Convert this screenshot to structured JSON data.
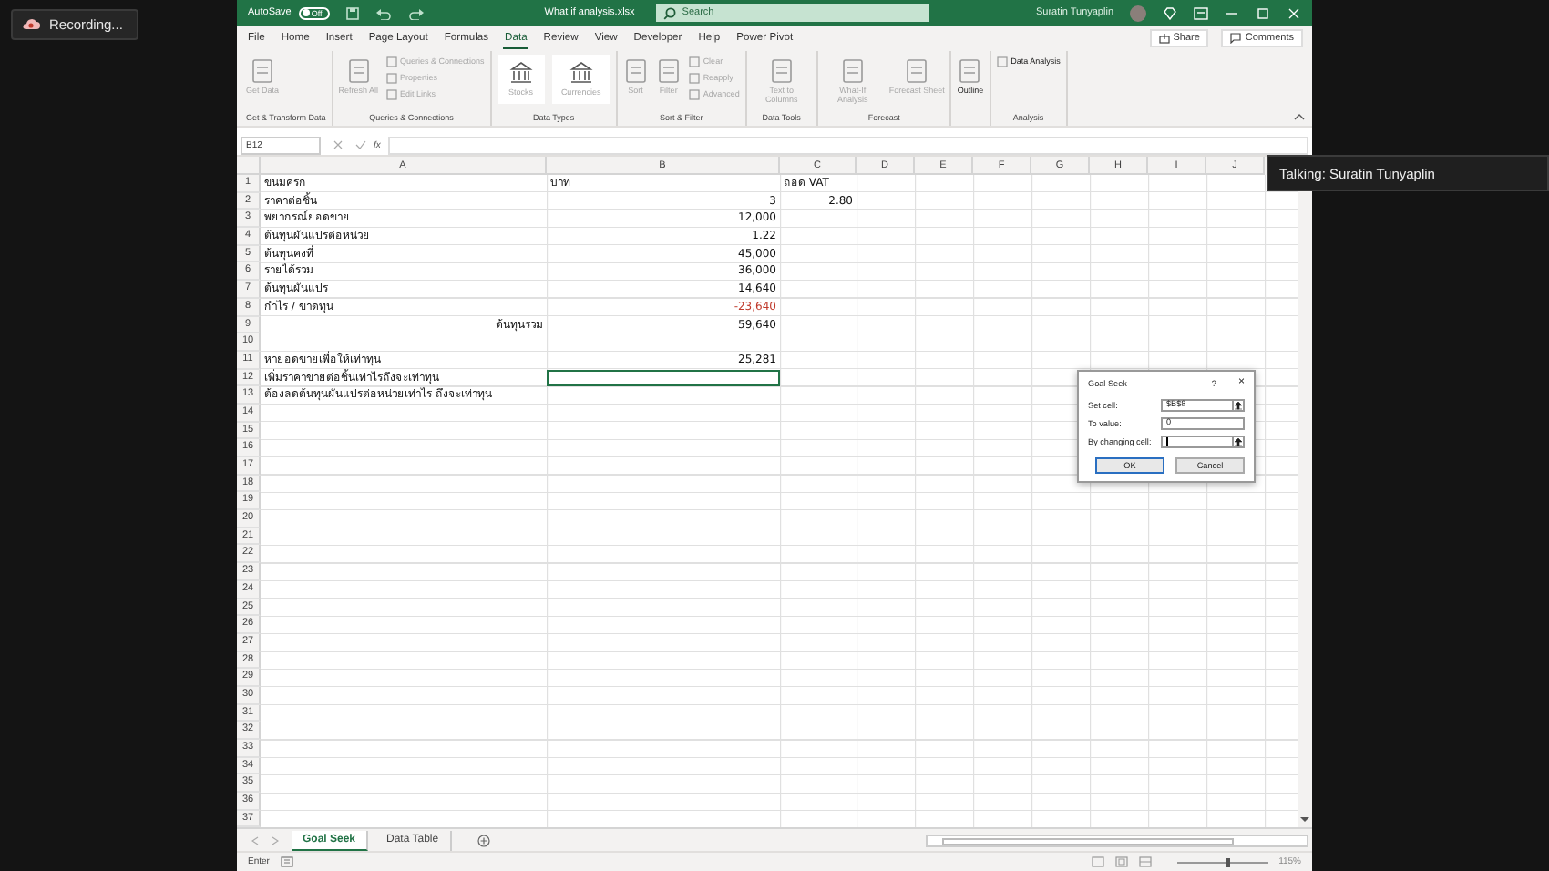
{
  "recording": {
    "label": "Recording..."
  },
  "talking": {
    "label": "Talking: Suratin Tunyaplin"
  },
  "title_bar": {
    "autosave_label": "AutoSave",
    "autosave_toggle": {
      "label": "Off",
      "on": false
    },
    "filename": "What if analysis.xlsx",
    "search": {
      "placeholder": "Search"
    },
    "user": "Suratin Tunyaplin"
  },
  "menu_tabs": [
    {
      "label": "File",
      "selected": false
    },
    {
      "label": "Home",
      "selected": false
    },
    {
      "label": "Insert",
      "selected": false
    },
    {
      "label": "Page Layout",
      "selected": false
    },
    {
      "label": "Formulas",
      "selected": false
    },
    {
      "label": "Data",
      "selected": true
    },
    {
      "label": "Review",
      "selected": false
    },
    {
      "label": "View",
      "selected": false
    },
    {
      "label": "Developer",
      "selected": false
    },
    {
      "label": "Help",
      "selected": false
    },
    {
      "label": "Power Pivot",
      "selected": false
    }
  ],
  "header_buttons": [
    "Share",
    "Comments"
  ],
  "ribbon_groups": [
    {
      "label": "Get & Transform Data",
      "items": [
        {
          "kind": "large",
          "label": "Get Data",
          "disabled": true
        }
      ]
    },
    {
      "label": "Queries & Connections",
      "items": [
        {
          "kind": "large",
          "label": "Refresh All",
          "disabled": true
        },
        {
          "kind": "small",
          "label": "Queries & Connections",
          "disabled": true
        },
        {
          "kind": "small",
          "label": "Properties",
          "disabled": true
        },
        {
          "kind": "small",
          "label": "Edit Links",
          "disabled": true
        }
      ]
    },
    {
      "label": "Data Types",
      "items": [
        {
          "kind": "gallery",
          "label": "Stocks",
          "disabled": true
        },
        {
          "kind": "gallery",
          "label": "Currencies",
          "disabled": true
        }
      ]
    },
    {
      "label": "Sort & Filter",
      "items": [
        {
          "kind": "large",
          "label": "Sort",
          "disabled": true
        },
        {
          "kind": "large",
          "label": "Filter",
          "disabled": true
        },
        {
          "kind": "small",
          "label": "Clear",
          "disabled": true
        },
        {
          "kind": "small",
          "label": "Reapply",
          "disabled": true
        },
        {
          "kind": "small",
          "label": "Advanced",
          "disabled": true
        }
      ]
    },
    {
      "label": "Data Tools",
      "items": [
        {
          "kind": "large",
          "label": "Text to Columns",
          "disabled": true
        }
      ]
    },
    {
      "label": "Forecast",
      "items": [
        {
          "kind": "large",
          "label": "What-If Analysis",
          "disabled": true
        },
        {
          "kind": "large",
          "label": "Forecast Sheet",
          "disabled": true
        }
      ]
    },
    {
      "items": [
        {
          "kind": "large",
          "label": "Outline",
          "disabled": false
        }
      ]
    },
    {
      "label": "Analysis",
      "items": [
        {
          "kind": "small",
          "label": "Data Analysis",
          "disabled": false
        }
      ]
    }
  ],
  "formula_bar": {
    "name_box": "B12",
    "fx": "fx"
  },
  "columns": [
    "A",
    "B",
    "C",
    "D",
    "E",
    "F",
    "G",
    "H",
    "I",
    "J"
  ],
  "rows": [
    {
      "number": "1",
      "a": {
        "text": "ขนมครก",
        "kind": "text"
      },
      "b": {
        "text": "บาท",
        "kind": "text"
      },
      "c": {
        "text": "ถอด VAT",
        "kind": "text"
      },
      "selected": false
    },
    {
      "number": "2",
      "a": {
        "text": "ราคาต่อชิ้น",
        "kind": "text"
      },
      "b": {
        "text": "3",
        "kind": "number"
      },
      "c": {
        "text": "2.80",
        "kind": "number"
      },
      "selected": false
    },
    {
      "number": "3",
      "a": {
        "text": "พยากรณ์ยอดขาย",
        "kind": "text"
      },
      "b": {
        "text": "12,000",
        "kind": "number"
      },
      "selected": false
    },
    {
      "number": "4",
      "a": {
        "text": "ต้นทุนผันแปรต่อหน่วย",
        "kind": "text"
      },
      "b": {
        "text": "1.22",
        "kind": "number"
      },
      "selected": false
    },
    {
      "number": "5",
      "a": {
        "text": "ต้นทุนคงที่",
        "kind": "text"
      },
      "b": {
        "text": "45,000",
        "kind": "number"
      },
      "selected": false
    },
    {
      "number": "6",
      "a": {
        "text": "รายได้รวม",
        "kind": "text"
      },
      "b": {
        "text": "36,000",
        "kind": "number"
      },
      "selected": false
    },
    {
      "number": "7",
      "a": {
        "text": "ต้นทุนผันแปร",
        "kind": "text"
      },
      "b": {
        "text": "14,640",
        "kind": "number"
      },
      "selected": false
    },
    {
      "number": "8",
      "a": {
        "text": "กำไร / ขาดทุน",
        "kind": "text"
      },
      "b": {
        "text": "-23,640",
        "kind": "negative"
      },
      "selected": false
    },
    {
      "number": "9",
      "a": {
        "text": "ต้นทุนรวม",
        "kind": "total-label"
      },
      "b": {
        "text": "59,640",
        "kind": "number"
      },
      "selected": false
    },
    {
      "number": "10",
      "selected": false
    },
    {
      "number": "11",
      "a": {
        "text": "หายอดขายเพื่อให้เท่าทุน",
        "kind": "text"
      },
      "b": {
        "text": "25,281",
        "kind": "number"
      },
      "selected": false
    },
    {
      "number": "12",
      "a": {
        "text": "เพิ่มราคาขายต่อชิ้นเท่าไรถึงจะเท่าทุน",
        "kind": "text"
      },
      "selected": true
    },
    {
      "number": "13",
      "a": {
        "text": "ต้องลดต้นทุนผันแปรต่อหน่วยเท่าไร ถึงจะเท่าทุน",
        "kind": "text"
      },
      "selected": false
    },
    {
      "number": "14",
      "selected": false
    },
    {
      "number": "15",
      "selected": false
    },
    {
      "number": "16",
      "selected": false
    },
    {
      "number": "17",
      "selected": false
    },
    {
      "number": "18",
      "selected": false
    },
    {
      "number": "19",
      "selected": false
    },
    {
      "number": "20",
      "selected": false
    },
    {
      "number": "21",
      "selected": false
    },
    {
      "number": "22",
      "selected": false
    },
    {
      "number": "23",
      "selected": false
    },
    {
      "number": "24",
      "selected": false
    },
    {
      "number": "25",
      "selected": false
    },
    {
      "number": "26",
      "selected": false
    },
    {
      "number": "27",
      "selected": false
    },
    {
      "number": "28",
      "selected": false
    },
    {
      "number": "29",
      "selected": false
    },
    {
      "number": "30",
      "selected": false
    },
    {
      "number": "31",
      "selected": false
    },
    {
      "number": "32",
      "selected": false
    },
    {
      "number": "33",
      "selected": false
    },
    {
      "number": "34",
      "selected": false
    },
    {
      "number": "35",
      "selected": false
    },
    {
      "number": "36",
      "selected": false
    },
    {
      "number": "37",
      "selected": false
    }
  ],
  "dialog": {
    "title": "Goal Seek",
    "help": "?",
    "close": "×",
    "fields": [
      {
        "label": "Set cell:",
        "value": "$B$8",
        "picker": true
      },
      {
        "label": "To value:",
        "value": "0",
        "picker": false
      },
      {
        "label": "By changing cell:",
        "picker": true
      }
    ],
    "buttons": [
      {
        "label": "OK",
        "default": true
      },
      {
        "label": "Cancel",
        "default": false
      }
    ]
  },
  "sheet_tabs": [
    {
      "label": "Goal Seek",
      "selected": true
    },
    {
      "label": "Data Table",
      "selected": false
    }
  ],
  "status_bar": {
    "mode": "Enter",
    "zoom_slider": {
      "level": 0.55
    },
    "zoom": "115%"
  }
}
